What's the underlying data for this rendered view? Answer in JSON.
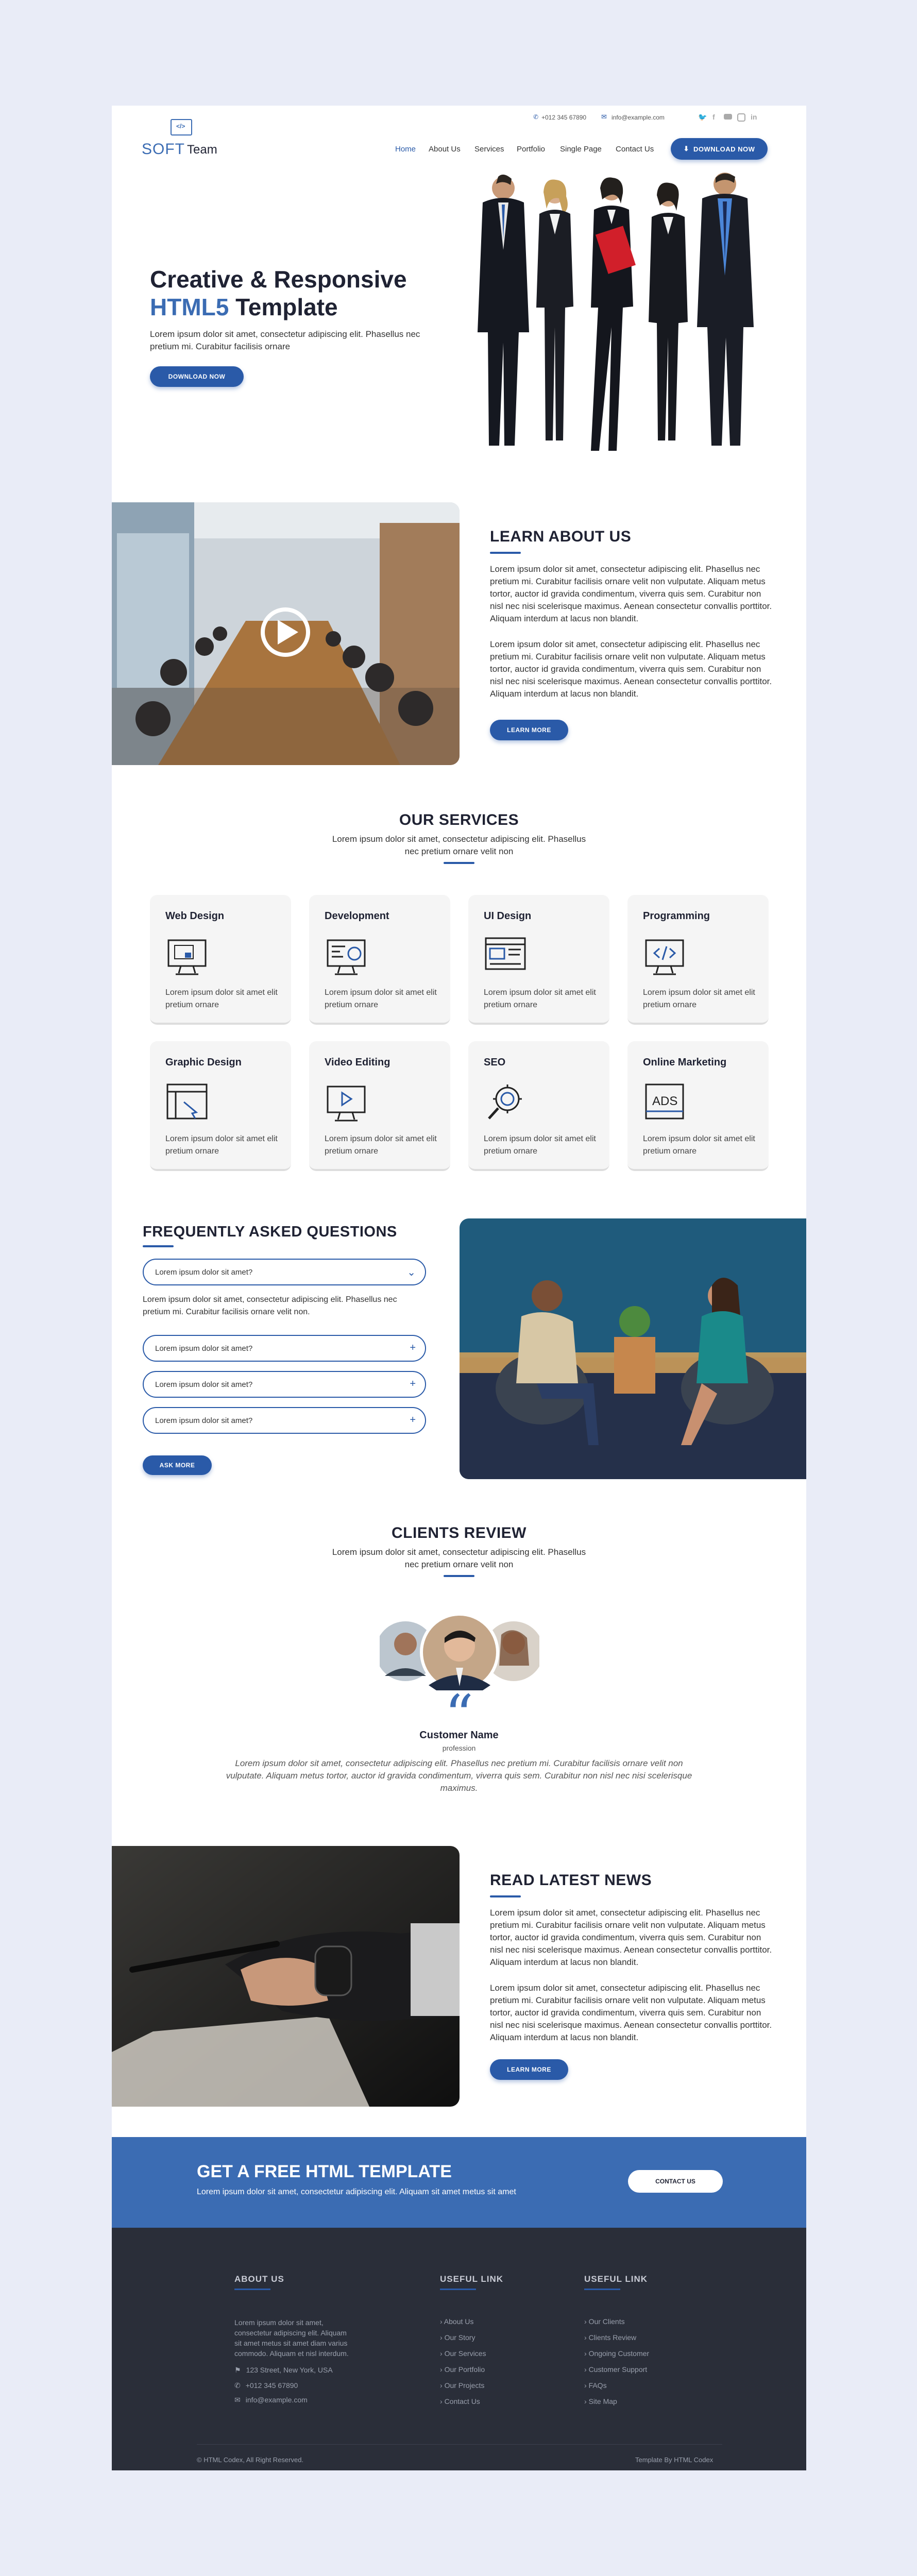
{
  "topbar": {
    "phone": "+012 345 67890",
    "email": "info@example.com",
    "social": [
      "twitter-icon",
      "facebook-icon",
      "youtube-icon",
      "instagram-icon",
      "linkedin-icon"
    ]
  },
  "logo": {
    "text_a": "SOFT",
    "text_b": "Team"
  },
  "nav": {
    "items": [
      "Home",
      "About Us",
      "Services",
      "Portfolio",
      "Single Page",
      "Contact Us"
    ],
    "active": "Home",
    "download": "DOWNLOAD NOW"
  },
  "hero": {
    "title_line1": "Creative & Responsive",
    "title_html": "HTML5",
    "title_rest": " Template",
    "text": "Lorem ipsum dolor sit amet, consectetur adipiscing elit. Phasellus nec pretium mi. Curabitur facilisis ornare",
    "button": "DOWNLOAD NOW"
  },
  "about": {
    "title": "LEARN ABOUT US",
    "p1": "Lorem ipsum dolor sit amet, consectetur adipiscing elit. Phasellus nec pretium mi. Curabitur facilisis ornare velit non vulputate. Aliquam metus tortor, auctor id gravida condimentum, viverra quis sem. Curabitur non nisl nec nisi scelerisque maximus. Aenean consectetur convallis porttitor. Aliquam interdum at lacus non blandit.",
    "p2": "Lorem ipsum dolor sit amet, consectetur adipiscing elit. Phasellus nec pretium mi. Curabitur facilisis ornare velit non vulputate. Aliquam metus tortor, auctor id gravida condimentum, viverra quis sem. Curabitur non nisl nec nisi scelerisque maximus. Aenean consectetur convallis porttitor. Aliquam interdum at lacus non blandit.",
    "button": "LEARN MORE"
  },
  "services": {
    "title": "OUR SERVICES",
    "subtitle": "Lorem ipsum dolor sit amet, consectetur adipiscing elit. Phasellus nec pretium ornare velit non",
    "items": [
      {
        "title": "Web Design",
        "icon": "web-design-icon",
        "text": "Lorem ipsum dolor sit amet elit pretium ornare"
      },
      {
        "title": "Development",
        "icon": "development-icon",
        "text": "Lorem ipsum dolor sit amet elit pretium ornare"
      },
      {
        "title": "UI Design",
        "icon": "ui-design-icon",
        "text": "Lorem ipsum dolor sit amet elit pretium ornare"
      },
      {
        "title": "Programming",
        "icon": "programming-icon",
        "text": "Lorem ipsum dolor sit amet elit pretium ornare"
      },
      {
        "title": "Graphic Design",
        "icon": "graphic-design-icon",
        "text": "Lorem ipsum dolor sit amet elit pretium ornare"
      },
      {
        "title": "Video Editing",
        "icon": "video-editing-icon",
        "text": "Lorem ipsum dolor sit amet elit pretium ornare"
      },
      {
        "title": "SEO",
        "icon": "seo-icon",
        "text": "Lorem ipsum dolor sit amet elit pretium ornare"
      },
      {
        "title": "Online Marketing",
        "icon": "online-marketing-icon",
        "text": "Lorem ipsum dolor sit amet elit pretium ornare"
      }
    ]
  },
  "faq": {
    "title": "FREQUENTLY ASKED QUESTIONS",
    "open_question": "Lorem ipsum dolor sit amet?",
    "answer": "Lorem ipsum dolor sit amet, consectetur adipiscing elit. Phasellus nec pretium mi. Curabitur facilisis ornare velit non.",
    "questions": [
      "Lorem ipsum dolor sit amet?",
      "Lorem ipsum dolor sit amet?",
      "Lorem ipsum dolor sit amet?"
    ],
    "button": "ASK MORE"
  },
  "clients": {
    "title": "CLIENTS REVIEW",
    "subtitle": "Lorem ipsum dolor sit amet, consectetur adipiscing elit. Phasellus nec pretium ornare velit non",
    "quote_mark": "“",
    "name": "Customer Name",
    "profession": "profession",
    "review": "Lorem ipsum dolor sit amet, consectetur adipiscing elit. Phasellus nec pretium mi. Curabitur facilisis ornare velit non vulputate. Aliquam metus tortor, auctor id gravida condimentum, viverra quis sem. Curabitur non nisl nec nisi scelerisque maximus."
  },
  "news": {
    "title": "READ LATEST NEWS",
    "p1": "Lorem ipsum dolor sit amet, consectetur adipiscing elit. Phasellus nec pretium mi. Curabitur facilisis ornare velit non vulputate. Aliquam metus tortor, auctor id gravida condimentum, viverra quis sem. Curabitur non nisl nec nisi scelerisque maximus. Aenean consectetur convallis porttitor. Aliquam interdum at lacus non blandit.",
    "p2": "Lorem ipsum dolor sit amet, consectetur adipiscing elit. Phasellus nec pretium mi. Curabitur facilisis ornare velit non vulputate. Aliquam metus tortor, auctor id gravida condimentum, viverra quis sem. Curabitur non nisl nec nisi scelerisque maximus. Aenean consectetur convallis porttitor. Aliquam interdum at lacus non blandit.",
    "button": "LEARN MORE"
  },
  "cta": {
    "title": "GET A FREE HTML TEMPLATE",
    "text": "Lorem ipsum dolor sit amet, consectetur adipiscing elit. Aliquam sit amet metus sit amet",
    "button": "CONTACT US"
  },
  "footer": {
    "about_title": "ABOUT US",
    "about_text": "Lorem ipsum dolor sit amet, consectetur adipiscing elit. Aliquam sit amet metus sit amet diam varius commodo. Aliquam et nisl interdum.",
    "address": "123 Street, New York, USA",
    "phone": "+012 345 67890",
    "email": "info@example.com",
    "useful1_title": "USEFUL LINK",
    "useful1": [
      "About Us",
      "Our Story",
      "Our Services",
      "Our Portfolio",
      "Our Projects",
      "Contact Us"
    ],
    "useful2_title": "USEFUL LINK",
    "useful2": [
      "Our Clients",
      "Clients Review",
      "Ongoing Customer",
      "Customer Support",
      "FAQs",
      "Site Map"
    ],
    "copyright": "© HTML Codex, All Right Reserved.",
    "credit": "Template By HTML Codex"
  },
  "colors": {
    "accent": "#2a5aa8",
    "dark": "#2a2e39",
    "cta": "#3b6cb3"
  }
}
